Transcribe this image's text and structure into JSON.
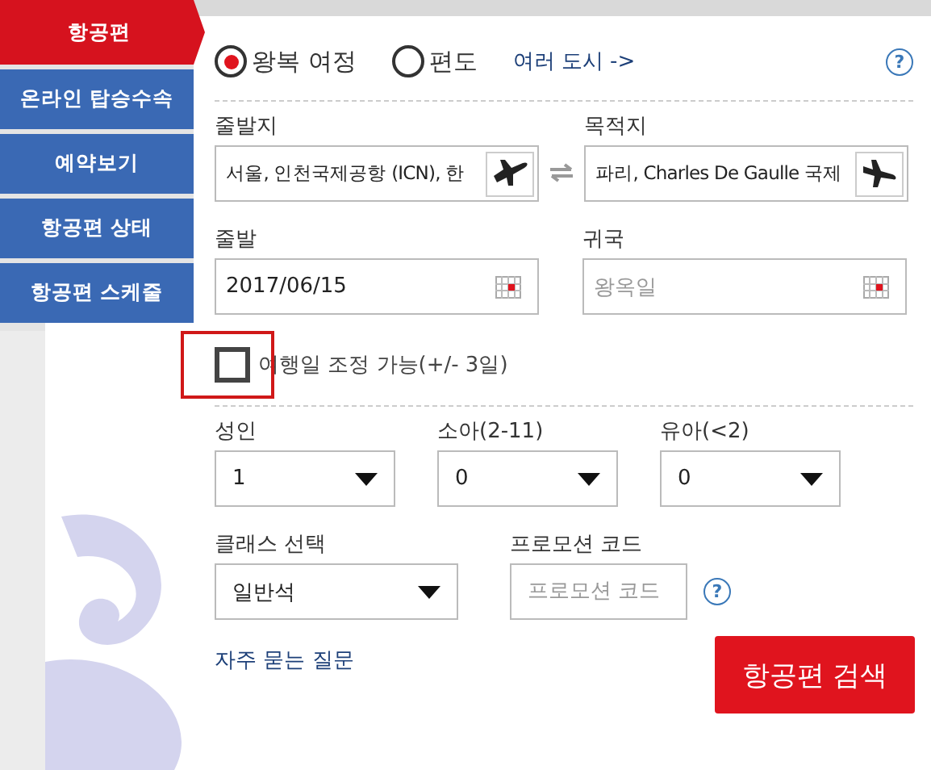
{
  "sidebar": {
    "items": [
      {
        "label": "항공편",
        "selected": true
      },
      {
        "label": "온라인 탑승수속",
        "selected": false
      },
      {
        "label": "예약보기",
        "selected": false
      },
      {
        "label": "항공편 상태",
        "selected": false
      },
      {
        "label": "항공편 스케줄",
        "selected": false
      }
    ]
  },
  "trip_types": [
    {
      "label": "왕복 여정",
      "selected": true
    },
    {
      "label": "편도",
      "selected": false
    }
  ],
  "multi_city_link": "여러 도시 ->",
  "help": "?",
  "origin": {
    "label": "줄발지",
    "value": "서울, 인천국제공항 (ICN), 한"
  },
  "destination": {
    "label": "목적지",
    "value": "파리, Charles De Gaulle 국제"
  },
  "departure": {
    "label": "줄발",
    "value": "2017/06/15"
  },
  "return": {
    "label": "귀국",
    "placeholder": "왕옥일"
  },
  "flexible_dates": {
    "label": "여행일 조정 가능(+/- 3일)",
    "checked": false,
    "highlighted": true
  },
  "passengers": [
    {
      "label": "성인",
      "value": "1"
    },
    {
      "label": "소아(2-11)",
      "value": "0"
    },
    {
      "label": "유아(<2)",
      "value": "0"
    }
  ],
  "cabin_class": {
    "label": "클래스 선택",
    "value": "일반석"
  },
  "promo_code": {
    "label": "프로모션 코드",
    "placeholder": "프로모션 코드",
    "help": "?"
  },
  "faq_link": "자주 묻는 질문",
  "search_button": "항공편 검색"
}
